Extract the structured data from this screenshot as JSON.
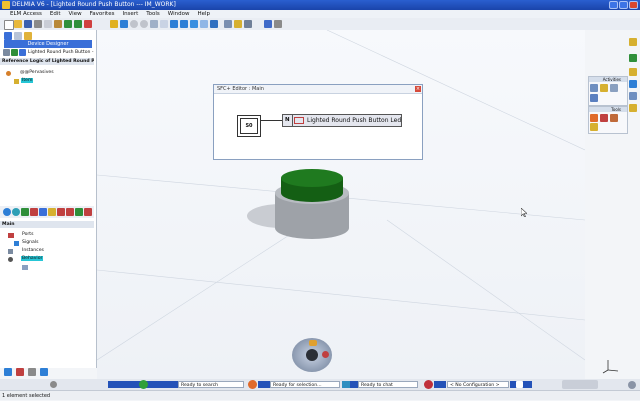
{
  "window": {
    "title": "DELMIA V6 - [Lighted Round Push Button --- IM_WORK]"
  },
  "menu": {
    "items": [
      "ELM Access",
      "Edit",
      "View",
      "Favorites",
      "Insert",
      "Tools",
      "Window",
      "Help"
    ]
  },
  "left_panel": {
    "tab_label": "Device Designer",
    "tab_row_label": "Lighted Round Push Button -...",
    "section1_title": "Reference Logic of Lighted Round Push B",
    "tree1": [
      "@@Pervasives",
      "Item"
    ],
    "section2_title": "Main",
    "tree2": [
      "Ports",
      "Signals",
      "Instances",
      "Behavior"
    ]
  },
  "sfc_editor": {
    "title": "SFC+ Editor : Main",
    "close_glyph": "×",
    "step_label": "S0",
    "action_qualifier": "N",
    "action_label": "Lighted Round Push Button Led"
  },
  "right_panel": {
    "activities_label": "Activities",
    "tools_label": "Tools"
  },
  "taskbar": {
    "search_status": "Ready to search",
    "selection_status": "Ready for selection...",
    "chat_status": "Ready to chat",
    "configuration": "< No Configuration >"
  },
  "status": {
    "message": "1 element selected"
  },
  "colors": {
    "title_blue": "#1a44aa",
    "button_green": "#1f7a1f",
    "accent_blue": "#3a6fd8"
  }
}
